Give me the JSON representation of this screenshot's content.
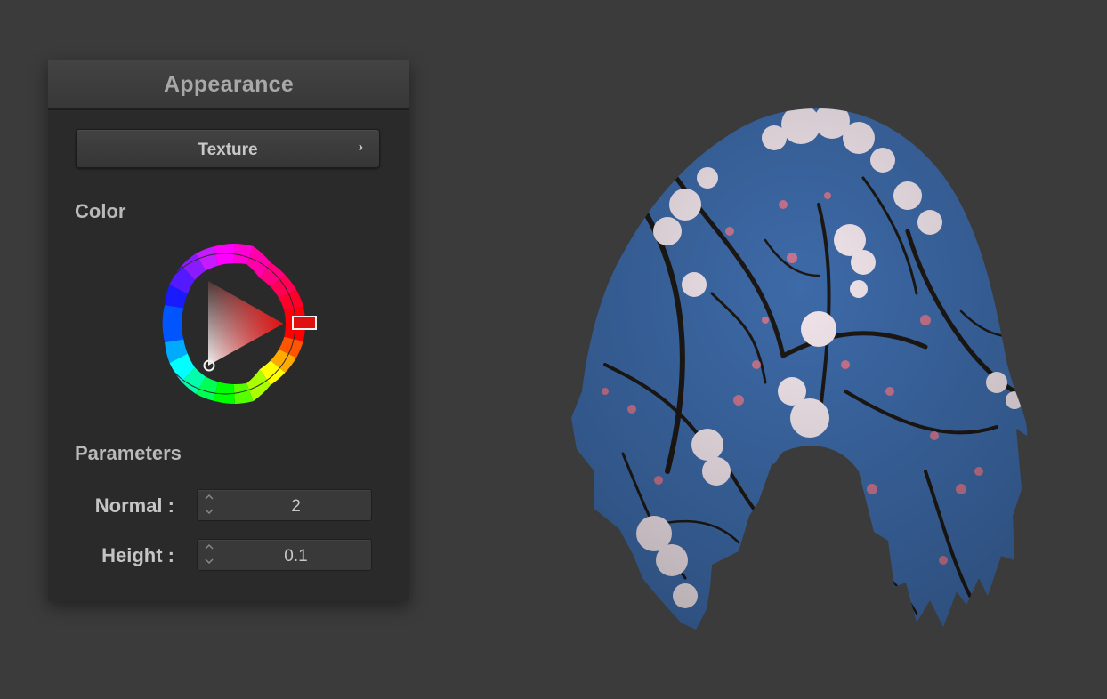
{
  "panel": {
    "title": "Appearance",
    "texture_button_label": "Texture",
    "texture_button_icon": "chevron-right-icon",
    "color_section_label": "Color",
    "parameters_section_label": "Parameters",
    "selected_color": "#e01010",
    "params": [
      {
        "label": "Normal :",
        "value": "2"
      },
      {
        "label": "Height :",
        "value": "0.1"
      }
    ]
  },
  "viewport": {
    "object": "draped cloth with cherry blossom texture",
    "sky_color": "#3d6aa8"
  }
}
